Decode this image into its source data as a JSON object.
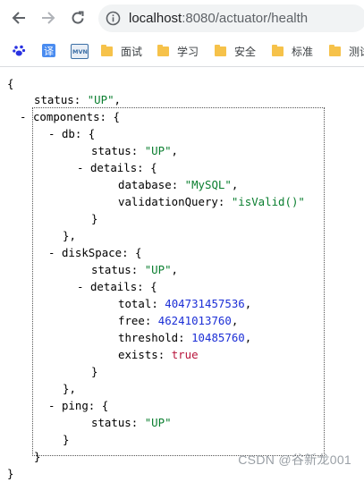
{
  "browser": {
    "url_host": "localhost",
    "url_port": ":8080",
    "url_path": "/actuator/health"
  },
  "bookmarks": [
    {
      "label": "",
      "icon": "baidu-paw-icon",
      "color": "#2932e1"
    },
    {
      "label": "",
      "icon": "translate-icon",
      "color": "#4a8cf0"
    },
    {
      "label": "",
      "icon": "mvn-icon",
      "color": "#3b6ea5"
    },
    {
      "label": "面试",
      "icon": "folder-icon"
    },
    {
      "label": "学习",
      "icon": "folder-icon"
    },
    {
      "label": "安全",
      "icon": "folder-icon"
    },
    {
      "label": "标准",
      "icon": "folder-icon"
    },
    {
      "label": "测试",
      "icon": "folder-icon"
    }
  ],
  "json": {
    "open_brace": "{",
    "status_key": "status",
    "status_val": "\"UP\"",
    "components_key": "components",
    "db_key": "db",
    "db_status_key": "status",
    "db_status_val": "\"UP\"",
    "db_details_key": "details",
    "database_key": "database",
    "database_val": "\"MySQL\"",
    "validation_key": "validationQuery",
    "validation_val": "\"isValid()\"",
    "disk_key": "diskSpace",
    "disk_status_key": "status",
    "disk_status_val": "\"UP\"",
    "disk_details_key": "details",
    "total_key": "total",
    "total_val": "404731457536",
    "free_key": "free",
    "free_val": "46241013760",
    "threshold_key": "threshold",
    "threshold_val": "10485760",
    "exists_key": "exists",
    "exists_val": "true",
    "ping_key": "ping",
    "ping_status_key": "status",
    "ping_status_val": "\"UP\""
  },
  "watermark": "CSDN @谷新龙001",
  "colors": {
    "string": "#0a7e2f",
    "number": "#1c2fd6",
    "boolean": "#b8153b"
  }
}
